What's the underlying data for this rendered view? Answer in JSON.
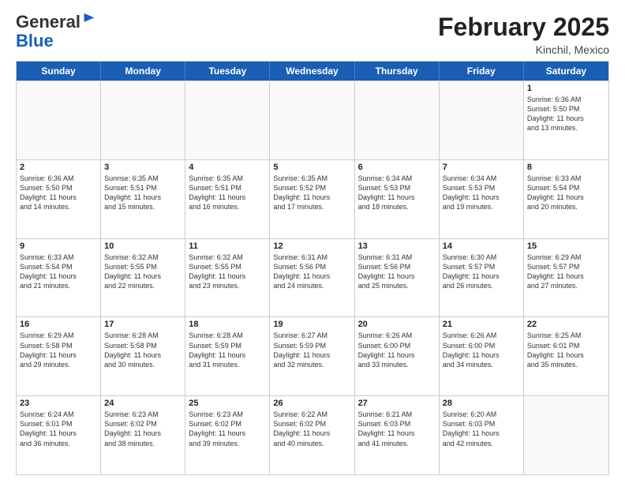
{
  "header": {
    "logo_general": "General",
    "logo_blue": "Blue",
    "month_title": "February 2025",
    "location": "Kinchil, Mexico"
  },
  "weekdays": [
    "Sunday",
    "Monday",
    "Tuesday",
    "Wednesday",
    "Thursday",
    "Friday",
    "Saturday"
  ],
  "weeks": [
    [
      {
        "day": "",
        "info": ""
      },
      {
        "day": "",
        "info": ""
      },
      {
        "day": "",
        "info": ""
      },
      {
        "day": "",
        "info": ""
      },
      {
        "day": "",
        "info": ""
      },
      {
        "day": "",
        "info": ""
      },
      {
        "day": "1",
        "info": "Sunrise: 6:36 AM\nSunset: 5:50 PM\nDaylight: 11 hours\nand 13 minutes."
      }
    ],
    [
      {
        "day": "2",
        "info": "Sunrise: 6:36 AM\nSunset: 5:50 PM\nDaylight: 11 hours\nand 14 minutes."
      },
      {
        "day": "3",
        "info": "Sunrise: 6:35 AM\nSunset: 5:51 PM\nDaylight: 11 hours\nand 15 minutes."
      },
      {
        "day": "4",
        "info": "Sunrise: 6:35 AM\nSunset: 5:51 PM\nDaylight: 11 hours\nand 16 minutes."
      },
      {
        "day": "5",
        "info": "Sunrise: 6:35 AM\nSunset: 5:52 PM\nDaylight: 11 hours\nand 17 minutes."
      },
      {
        "day": "6",
        "info": "Sunrise: 6:34 AM\nSunset: 5:53 PM\nDaylight: 11 hours\nand 18 minutes."
      },
      {
        "day": "7",
        "info": "Sunrise: 6:34 AM\nSunset: 5:53 PM\nDaylight: 11 hours\nand 19 minutes."
      },
      {
        "day": "8",
        "info": "Sunrise: 6:33 AM\nSunset: 5:54 PM\nDaylight: 11 hours\nand 20 minutes."
      }
    ],
    [
      {
        "day": "9",
        "info": "Sunrise: 6:33 AM\nSunset: 5:54 PM\nDaylight: 11 hours\nand 21 minutes."
      },
      {
        "day": "10",
        "info": "Sunrise: 6:32 AM\nSunset: 5:55 PM\nDaylight: 11 hours\nand 22 minutes."
      },
      {
        "day": "11",
        "info": "Sunrise: 6:32 AM\nSunset: 5:55 PM\nDaylight: 11 hours\nand 23 minutes."
      },
      {
        "day": "12",
        "info": "Sunrise: 6:31 AM\nSunset: 5:56 PM\nDaylight: 11 hours\nand 24 minutes."
      },
      {
        "day": "13",
        "info": "Sunrise: 6:31 AM\nSunset: 5:56 PM\nDaylight: 11 hours\nand 25 minutes."
      },
      {
        "day": "14",
        "info": "Sunrise: 6:30 AM\nSunset: 5:57 PM\nDaylight: 11 hours\nand 26 minutes."
      },
      {
        "day": "15",
        "info": "Sunrise: 6:29 AM\nSunset: 5:57 PM\nDaylight: 11 hours\nand 27 minutes."
      }
    ],
    [
      {
        "day": "16",
        "info": "Sunrise: 6:29 AM\nSunset: 5:58 PM\nDaylight: 11 hours\nand 29 minutes."
      },
      {
        "day": "17",
        "info": "Sunrise: 6:28 AM\nSunset: 5:58 PM\nDaylight: 11 hours\nand 30 minutes."
      },
      {
        "day": "18",
        "info": "Sunrise: 6:28 AM\nSunset: 5:59 PM\nDaylight: 11 hours\nand 31 minutes."
      },
      {
        "day": "19",
        "info": "Sunrise: 6:27 AM\nSunset: 5:59 PM\nDaylight: 11 hours\nand 32 minutes."
      },
      {
        "day": "20",
        "info": "Sunrise: 6:26 AM\nSunset: 6:00 PM\nDaylight: 11 hours\nand 33 minutes."
      },
      {
        "day": "21",
        "info": "Sunrise: 6:26 AM\nSunset: 6:00 PM\nDaylight: 11 hours\nand 34 minutes."
      },
      {
        "day": "22",
        "info": "Sunrise: 6:25 AM\nSunset: 6:01 PM\nDaylight: 11 hours\nand 35 minutes."
      }
    ],
    [
      {
        "day": "23",
        "info": "Sunrise: 6:24 AM\nSunset: 6:01 PM\nDaylight: 11 hours\nand 36 minutes."
      },
      {
        "day": "24",
        "info": "Sunrise: 6:23 AM\nSunset: 6:02 PM\nDaylight: 11 hours\nand 38 minutes."
      },
      {
        "day": "25",
        "info": "Sunrise: 6:23 AM\nSunset: 6:02 PM\nDaylight: 11 hours\nand 39 minutes."
      },
      {
        "day": "26",
        "info": "Sunrise: 6:22 AM\nSunset: 6:02 PM\nDaylight: 11 hours\nand 40 minutes."
      },
      {
        "day": "27",
        "info": "Sunrise: 6:21 AM\nSunset: 6:03 PM\nDaylight: 11 hours\nand 41 minutes."
      },
      {
        "day": "28",
        "info": "Sunrise: 6:20 AM\nSunset: 6:03 PM\nDaylight: 11 hours\nand 42 minutes."
      },
      {
        "day": "",
        "info": ""
      }
    ]
  ]
}
